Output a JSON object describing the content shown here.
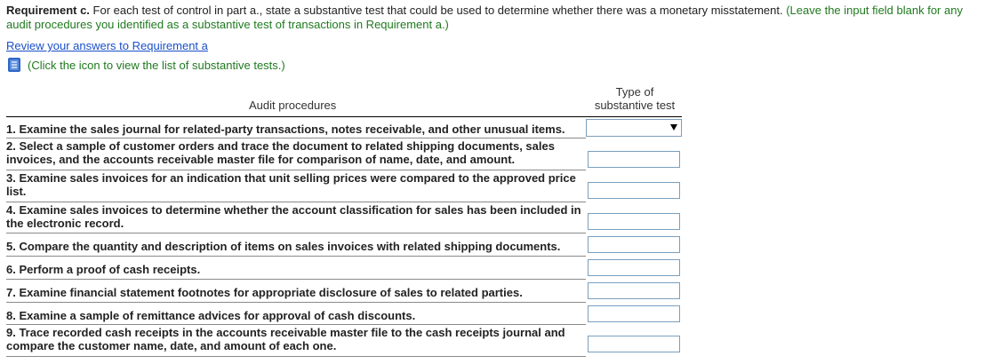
{
  "requirement": {
    "label": "Requirement c.",
    "text": " For each test of control in part a., state a substantive test that could be used to determine whether there was a monetary misstatement.",
    "note": " (Leave the input field blank for any audit procedures you identified as a substantive test of transactions in Requirement a.)"
  },
  "review_link": "Review your answers to Requirement a",
  "icon_note": "(Click the icon to view the list of substantive tests.)",
  "table": {
    "col_procedures": "Audit procedures",
    "col_type_line1": "Type of",
    "col_type_line2": "substantive test",
    "rows": [
      {
        "procedure": "1. Examine the sales journal for related-party transactions, notes receivable, and other unusual items.",
        "type": ""
      },
      {
        "procedure": "2. Select a sample of customer orders and trace the document to related shipping documents, sales invoices, and the accounts receivable master file for comparison of name, date, and amount.",
        "type": ""
      },
      {
        "procedure": "3. Examine sales invoices for an indication that unit selling prices were compared to the approved price list.",
        "type": ""
      },
      {
        "procedure": "4. Examine sales invoices to determine whether the account classification for sales has been included in the electronic record.",
        "type": ""
      },
      {
        "procedure": "5. Compare the quantity and description of items on sales invoices with related shipping documents.",
        "type": ""
      },
      {
        "procedure": "6. Perform a proof of cash receipts.",
        "type": ""
      },
      {
        "procedure": "7. Examine financial statement footnotes for appropriate disclosure of sales to related parties.",
        "type": ""
      },
      {
        "procedure": "8. Examine a sample of remittance advices for approval of cash discounts.",
        "type": ""
      },
      {
        "procedure": "9. Trace recorded cash receipts in the accounts receivable master file to the cash receipts journal and compare the customer name, date, and amount of each one.",
        "type": ""
      }
    ]
  },
  "colors": {
    "link": "#1a4fc9",
    "note_green": "#1f7a1f",
    "field_border": "#7a9fbd",
    "icon_blue": "#2f66c4"
  }
}
